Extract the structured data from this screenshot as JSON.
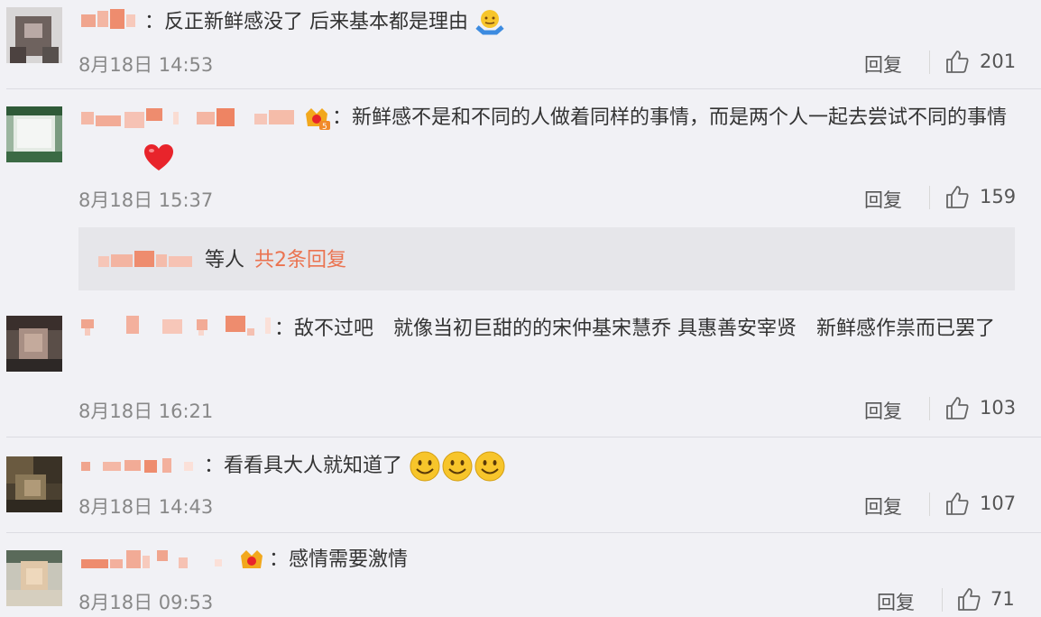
{
  "comments": [
    {
      "text": "：反正新鲜感没了 后来基本都是理由",
      "time": "8月18日 14:53",
      "reply_label": "回复",
      "likes": "201"
    },
    {
      "text": "：新鲜感不是和不同的人做着同样的事情，而是两个人一起去尝试不同的事情",
      "time": "8月18日 15:37",
      "reply_label": "回复",
      "likes": "159",
      "vip_level": "5",
      "sub_replies": {
        "suffix": "等人",
        "link": "共2条回复"
      }
    },
    {
      "text": "：敌不过吧　就像当初巨甜的的宋仲基宋慧乔 具惠善安宰贤　新鲜感作祟而已罢了",
      "time": "8月18日 16:21",
      "reply_label": "回复",
      "likes": "103"
    },
    {
      "text": "：看看具大人就知道了",
      "time": "8月18日 14:43",
      "reply_label": "回复",
      "likes": "107"
    },
    {
      "text": "：感情需要激情",
      "time": "8月18日 09:53",
      "reply_label": "回复",
      "likes": "71"
    }
  ],
  "colors": {
    "background": "#f1f1f5",
    "name_mosaic": "#f0a58e",
    "link": "#eb7350",
    "heart": "#e8242b",
    "smiley": "#f7c52b"
  },
  "icons": [
    "shrug-emoji",
    "heart-emoji",
    "smiley-emoji",
    "crown-badge-icon",
    "thumbs-up-icon"
  ]
}
